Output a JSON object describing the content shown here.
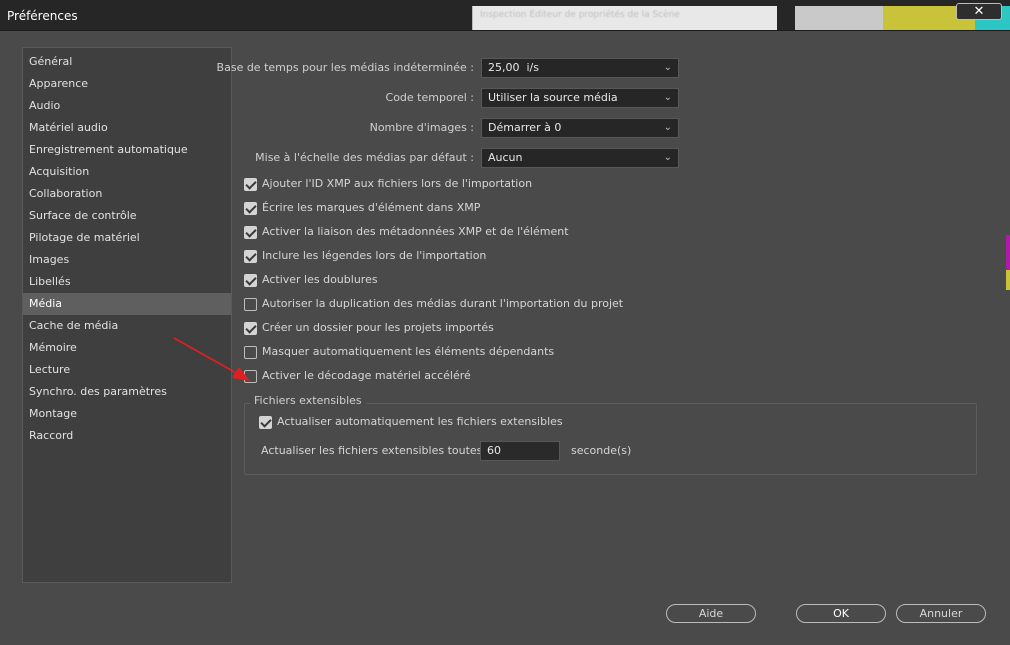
{
  "window": {
    "title": "Préférences",
    "close_glyph": "✕"
  },
  "background_hint": "Inspection Éditeur de propriétés de la Scène",
  "colors": {
    "accent_yellow": "#c9c33a",
    "accent_magenta": "#b01aa8",
    "accent_cyan": "#2cc7c4"
  },
  "sidebar": {
    "items": [
      "Général",
      "Apparence",
      "Audio",
      "Matériel audio",
      "Enregistrement automatique",
      "Acquisition",
      "Collaboration",
      "Surface de contrôle",
      "Pilotage de matériel",
      "Images",
      "Libellés",
      "Média",
      "Cache de média",
      "Mémoire",
      "Lecture",
      "Synchro. des paramètres",
      "Montage",
      "Raccord"
    ],
    "selected": "Média"
  },
  "fields": {
    "timebase": {
      "label": "Base de temps pour les médias indéterminée :",
      "value": "25,00  i/s"
    },
    "timecode": {
      "label": "Code temporel :",
      "value": "Utiliser la source média"
    },
    "frame_count": {
      "label": "Nombre d'images :",
      "value": "Démarrer à 0"
    },
    "scale": {
      "label": "Mise à l'échelle des médias par défaut :",
      "value": "Aucun"
    }
  },
  "checkboxes": [
    {
      "label": "Ajouter l'ID XMP aux fichiers lors de l'importation",
      "checked": true
    },
    {
      "label": "Écrire les marques d'élément dans XMP",
      "checked": true
    },
    {
      "label": "Activer la liaison des métadonnées XMP et de l'élément",
      "checked": true
    },
    {
      "label": "Inclure les légendes lors de l'importation",
      "checked": true
    },
    {
      "label": "Activer les doublures",
      "checked": true
    },
    {
      "label": "Autoriser la duplication des médias durant l'importation du projet",
      "checked": false
    },
    {
      "label": "Créer un dossier pour les projets importés",
      "checked": true
    },
    {
      "label": "Masquer automatiquement les éléments dépendants",
      "checked": false
    },
    {
      "label": "Activer le décodage matériel accéléré",
      "checked": false
    }
  ],
  "growing_files": {
    "title": "Fichiers extensibles",
    "auto_refresh": {
      "label": "Actualiser automatiquement les fichiers extensibles",
      "checked": true
    },
    "interval_label": "Actualiser les fichiers extensibles toutes les",
    "interval_value": "60",
    "interval_unit": "seconde(s)"
  },
  "buttons": {
    "help": "Aide",
    "ok": "OK",
    "cancel": "Annuler"
  },
  "icons": {
    "dropdown": "chevron-down-icon",
    "annotation": "red-arrow-icon"
  }
}
